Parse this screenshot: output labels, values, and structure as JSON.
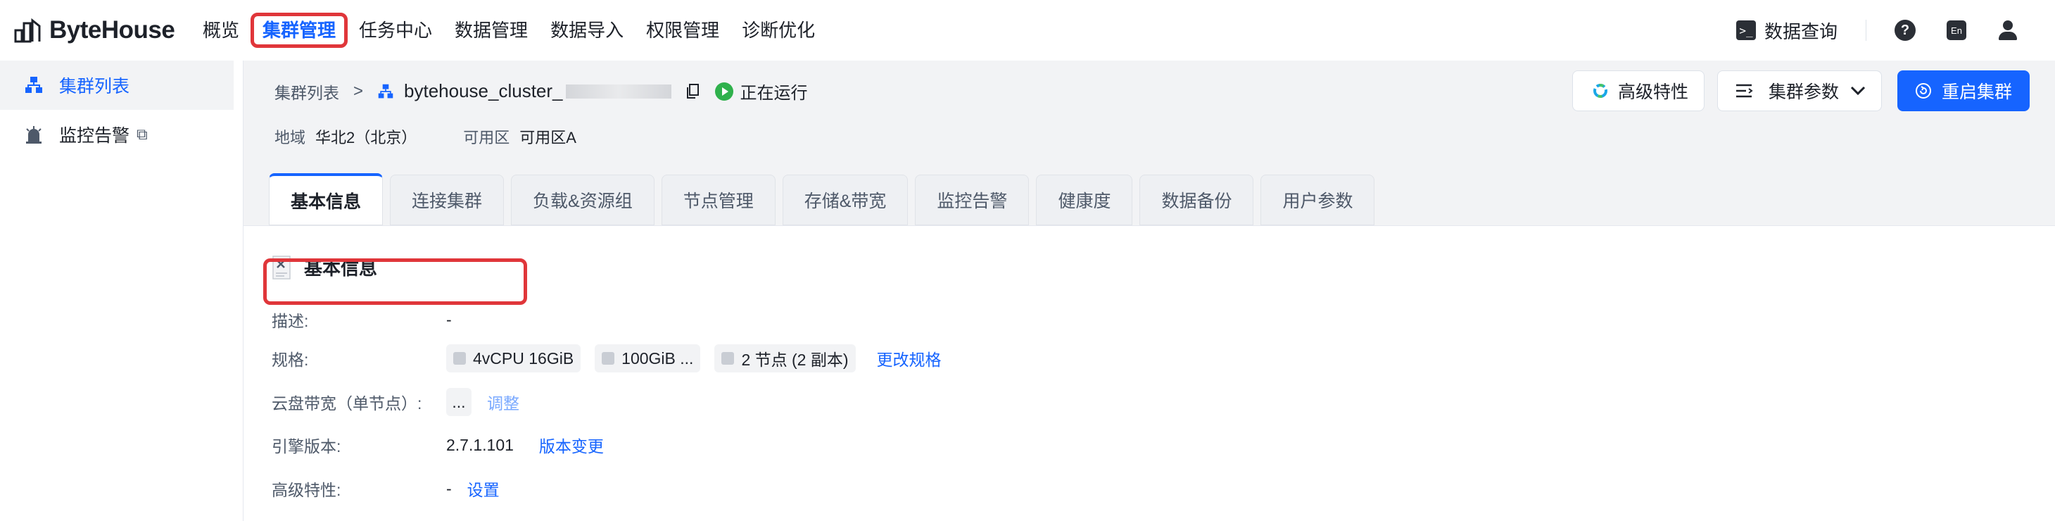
{
  "topbar": {
    "logo_text": "ByteHouse",
    "nav": [
      "概览",
      "集群管理",
      "任务中心",
      "数据管理",
      "数据导入",
      "权限管理",
      "诊断优化"
    ],
    "active_nav": "集群管理",
    "query_label": "数据查询",
    "help_icon": "question-circle-icon",
    "lang_label": "En",
    "user_icon": "user-icon"
  },
  "sidebar": {
    "items": [
      {
        "label": "集群列表",
        "icon": "cluster-icon",
        "active": true
      },
      {
        "label": "监控告警",
        "icon": "alarm-icon",
        "external": true
      }
    ]
  },
  "header": {
    "breadcrumb_root": "集群列表",
    "breadcrumb_sep": ">",
    "cluster_name": "bytehouse_cluster_",
    "status": "正在运行",
    "region_label": "地域",
    "region_value": "华北2（北京）",
    "zone_label": "可用区",
    "zone_value": "可用区A",
    "buttons": {
      "advanced": "高级特性",
      "params": "集群参数",
      "restart": "重启集群"
    }
  },
  "tabs": [
    "基本信息",
    "连接集群",
    "负载&资源组",
    "节点管理",
    "存储&带宽",
    "监控告警",
    "健康度",
    "数据备份",
    "用户参数"
  ],
  "active_tab": "基本信息",
  "basic_info": {
    "title": "基本信息",
    "desc_label": "描述:",
    "desc_value": "-",
    "spec_label": "规格:",
    "spec_cpu": "4vCPU 16GiB",
    "spec_disk": "100GiB ...",
    "spec_nodes": "2 节点 (2 副本)",
    "spec_change": "更改规格",
    "bw_label": "云盘带宽（单节点）:",
    "bw_value": "...",
    "bw_adjust": "调整",
    "engine_label": "引擎版本:",
    "engine_value": "2.7.1.101",
    "engine_change": "版本变更",
    "adv_label": "高级特性:",
    "adv_value": "-",
    "adv_set": "设置"
  },
  "colors": {
    "accent": "#1664ff",
    "highlight": "#e0363a",
    "running": "#2fb14c"
  }
}
